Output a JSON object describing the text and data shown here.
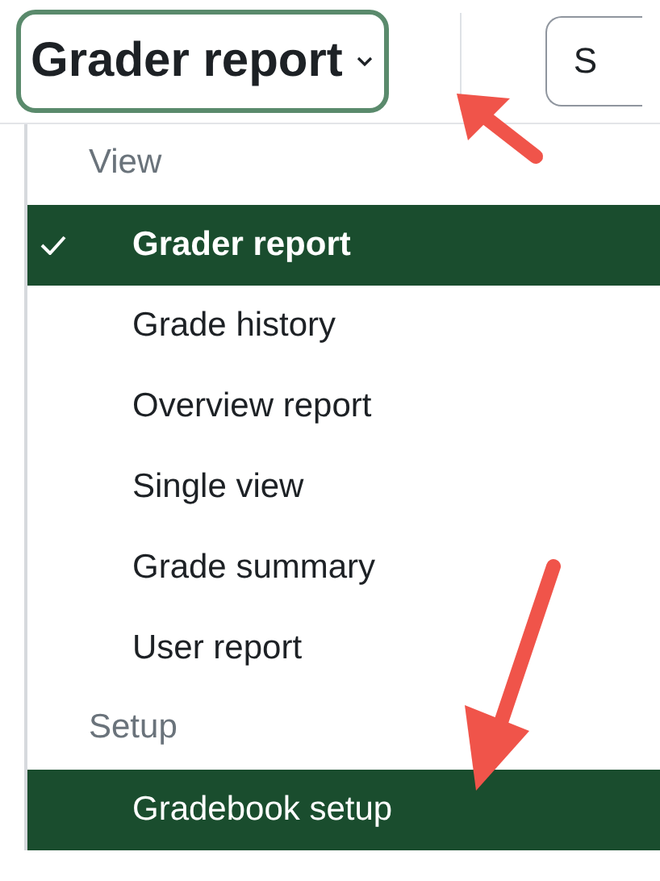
{
  "report_selector": {
    "label": "Grader report"
  },
  "side_button": {
    "label": "S"
  },
  "menu": {
    "sections": [
      {
        "heading": "View",
        "items": [
          {
            "label": "Grader report",
            "checked": true,
            "selected": true
          },
          {
            "label": "Grade history",
            "checked": false,
            "selected": false
          },
          {
            "label": "Overview report",
            "checked": false,
            "selected": false
          },
          {
            "label": "Single view",
            "checked": false,
            "selected": false
          },
          {
            "label": "Grade summary",
            "checked": false,
            "selected": false
          },
          {
            "label": "User report",
            "checked": false,
            "selected": false
          }
        ]
      },
      {
        "heading": "Setup",
        "items": [
          {
            "label": "Gradebook setup",
            "checked": false,
            "selected": true
          }
        ]
      }
    ]
  }
}
